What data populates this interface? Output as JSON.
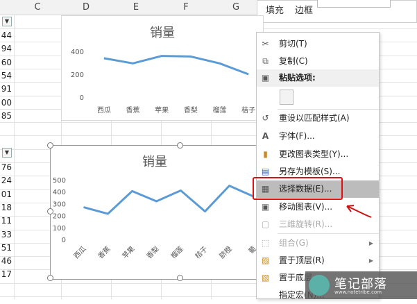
{
  "spreadsheet": {
    "columns": [
      "C",
      "D",
      "E",
      "F",
      "G"
    ],
    "colA_values_top": [
      "44",
      "94",
      "60",
      "54",
      "91",
      "00",
      "85"
    ],
    "colA_values_bottom": [
      "76",
      "24",
      "01",
      "18",
      "11",
      "33",
      "51",
      "46",
      "17"
    ]
  },
  "ribbon": {
    "fill_label": "填充",
    "border_label": "边框"
  },
  "charts": [
    {
      "title": "销量",
      "chart_data": {
        "type": "line",
        "title": "销量",
        "categories": [
          "西瓜",
          "香蕉",
          "苹果",
          "香梨",
          "榴莲",
          "桔子"
        ],
        "values": [
          340,
          295,
          360,
          355,
          295,
          200
        ],
        "ylim": [
          0,
          400
        ],
        "yticks": [
          "400",
          "200",
          "0"
        ],
        "color": "#5b9bd5"
      }
    },
    {
      "title": "销量",
      "chart_data": {
        "type": "line",
        "title": "销量",
        "categories": [
          "西瓜",
          "香蕉",
          "苹果",
          "香梨",
          "榴莲",
          "桔子",
          "脐橙",
          "葡"
        ],
        "values": [
          270,
          215,
          405,
          320,
          410,
          235,
          450,
          360
        ],
        "ylim": [
          0,
          500
        ],
        "yticks": [
          "500",
          "400",
          "300",
          "200",
          "100",
          "0"
        ],
        "color": "#5b9bd5"
      }
    }
  ],
  "context_menu": {
    "items": [
      {
        "label": "剪切(T)",
        "icon": "scissors-icon",
        "glyph": "✂",
        "enabled": true
      },
      {
        "label": "复制(C)",
        "icon": "copy-icon",
        "glyph": "⧉",
        "enabled": true
      },
      {
        "label": "粘贴选项:",
        "icon": "paste-icon",
        "glyph": "📋",
        "enabled": true,
        "bold": true
      },
      {
        "label": "重设以匹配样式(A)",
        "icon": "reset-style-icon",
        "glyph": "↺",
        "enabled": true
      },
      {
        "label": "字体(F)...",
        "icon": "font-icon",
        "glyph": "A",
        "enabled": true
      },
      {
        "label": "更改图表类型(Y)...",
        "icon": "chart-type-icon",
        "glyph": "▮",
        "enabled": true
      },
      {
        "label": "另存为模板(S)...",
        "icon": "save-template-icon",
        "glyph": "▤",
        "enabled": true
      },
      {
        "label": "选择数据(E)...",
        "icon": "select-data-icon",
        "glyph": "▦",
        "enabled": true,
        "highlighted": true
      },
      {
        "label": "移动图表(V)...",
        "icon": "move-chart-icon",
        "glyph": "▣",
        "enabled": true
      },
      {
        "label": "三维旋转(R)...",
        "icon": "3d-rotate-icon",
        "glyph": "▢",
        "enabled": false
      },
      {
        "label": "组合(G)",
        "icon": "group-icon",
        "glyph": "⬚",
        "enabled": false,
        "submenu": true
      },
      {
        "label": "置于顶层(R)",
        "icon": "bring-front-icon",
        "glyph": "▨",
        "enabled": true,
        "submenu": true
      },
      {
        "label": "置于底层",
        "icon": "send-back-icon",
        "glyph": "▧",
        "enabled": true,
        "submenu": true
      },
      {
        "label": "指定宏(N)...",
        "icon": "macro-icon",
        "glyph": "",
        "enabled": true
      }
    ]
  },
  "annotation": {
    "color": "#cc1111"
  },
  "watermark": {
    "text": "笔记部落",
    "url": "www.notetribe.com"
  }
}
